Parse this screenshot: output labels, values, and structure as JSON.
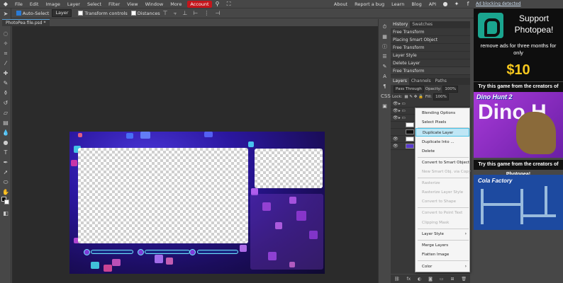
{
  "menu": {
    "items": [
      "File",
      "Edit",
      "Image",
      "Layer",
      "Select",
      "Filter",
      "View",
      "Window",
      "More"
    ],
    "account": "Account",
    "right_links": [
      "About",
      "Report a bug",
      "Learn",
      "Blog",
      "API"
    ]
  },
  "options": {
    "auto_select": "Auto-Select",
    "target": "Layer",
    "transform_controls": "Transform controls",
    "distances": "Distances"
  },
  "tabs": [
    {
      "label": "PhotoPea file.psd *"
    }
  ],
  "history": {
    "tabs": [
      "History",
      "Swatches"
    ],
    "rows": [
      "Free Transform",
      "Placing Smart Object",
      "Free Transform",
      "Layer Style",
      "Delete Layer",
      "Free Transform"
    ]
  },
  "layers": {
    "tabs": [
      "Layers",
      "Channels",
      "Paths"
    ],
    "blend": "Pass Through",
    "opacity_label": "Opacity:",
    "opacity": "100%",
    "lock_label": "Lock:",
    "fill_label": "Fill:",
    "fill": "100%"
  },
  "context_menu": {
    "items": [
      "Blending Options",
      "Select Pixels",
      "Duplicate Layer",
      "Duplicate Into ...",
      "Delete",
      "Convert to Smart Object",
      "New Smart Obj. via Copy",
      "Rasterize",
      "Rasterize Layer Style",
      "Convert to Shape",
      "Convert to Point Text",
      "Clipping Mask",
      "Layer Style",
      "Merge Layers",
      "Flatten Image",
      "Color"
    ],
    "highlighted": "Duplicate Layer"
  },
  "ads": {
    "adblock_link": "Ad blocking detected",
    "support_title": "Support Photopea!",
    "support_body": "remove ads for three months for only",
    "price": "$10",
    "game_banner": "Try this game from the creators of Photopea!",
    "game1_title": "Dino Hunt 2",
    "game1_big": "Dino H",
    "game2_title": "Cola Factory"
  },
  "colors": {
    "accent": "#c4161c",
    "highlight": "#bfe6f5",
    "brand": "#1aa58f",
    "price": "#f7c81e"
  }
}
